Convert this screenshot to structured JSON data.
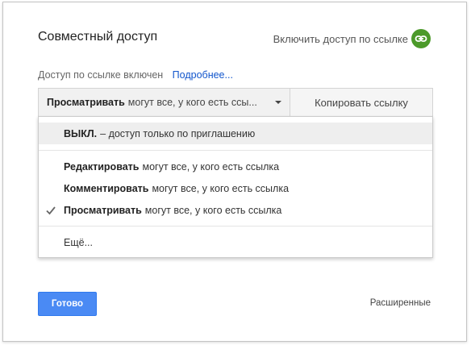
{
  "dialog": {
    "title": "Совместный доступ",
    "link_toggle_label": "Включить доступ по ссылке",
    "link_icon": "link-icon",
    "status_text": "Доступ по ссылке включен",
    "learn_more": "Подробнее...",
    "permission": {
      "bold": "Просматривать",
      "rest": "могут все, у кого есть ссы..."
    },
    "copy_link": "Копировать ссылку",
    "menu": {
      "items": [
        {
          "bold": "ВЫКЛ.",
          "rest": "– доступ только по приглашению",
          "highlighted": true
        },
        {
          "bold": "Редактировать",
          "rest": "могут все, у кого есть ссылка"
        },
        {
          "bold": "Комментировать",
          "rest": "могут все, у кого есть ссылка"
        },
        {
          "bold": "Просматривать",
          "rest": "могут все, у кого есть ссылка",
          "checked": true
        },
        {
          "bold": "",
          "rest": "Ещё..."
        }
      ]
    },
    "done_button": "Готово",
    "advanced_link": "Расширенные"
  },
  "colors": {
    "accent_blue": "#4a8af4",
    "link_green": "#4c9a2a",
    "link_text": "#15c"
  }
}
